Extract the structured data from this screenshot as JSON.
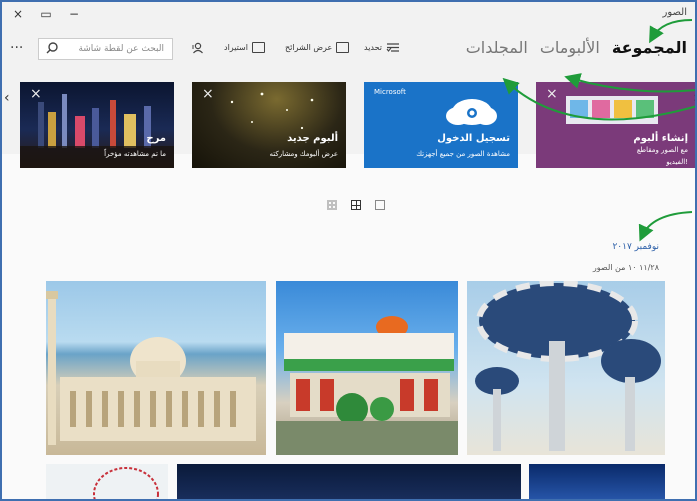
{
  "window": {
    "app_title": "الصور",
    "close_glyph": "×",
    "restore_glyph": "▭",
    "minimize_glyph": "−"
  },
  "toolbar": {
    "more_glyph": "···",
    "search_placeholder": "البحث عن لقطة شاشة",
    "items": [
      {
        "label": "تحديد",
        "icon": "select-icon"
      },
      {
        "label": "عرض الشرائح",
        "icon": "slideshow-icon"
      },
      {
        "label": "استيراد",
        "icon": "import-icon"
      }
    ]
  },
  "tabs": [
    {
      "label": "المجموعة",
      "active": true
    },
    {
      "label": "الألبومات",
      "active": false
    },
    {
      "label": "المجلدات",
      "active": false
    }
  ],
  "tiles": [
    {
      "title": "إنشاء ألبوم",
      "subtitle": "مع الصور ومقاطع",
      "extra": "الفيديو!",
      "color": "#7b3a7a"
    },
    {
      "title": "تسجيل الدخول",
      "subtitle": "مشاهدة الصور من جميع أجهزتك",
      "badge": "Microsoft",
      "color": "#1a73c8"
    },
    {
      "title": "ألبوم جديد",
      "subtitle": "عرض ألبومك ومشاركته",
      "color": "#3a3320"
    },
    {
      "title": "مرح",
      "subtitle": "ما تم مشاهدته مؤخراً",
      "color": "#101830"
    }
  ],
  "collection": {
    "date": "نوفمبر ٢٠١٧",
    "summary": "١١/٢٨    ١٠ من الصور"
  },
  "colors": {
    "accent": "#2c5fa8",
    "annotation": "#1f9c3a"
  }
}
